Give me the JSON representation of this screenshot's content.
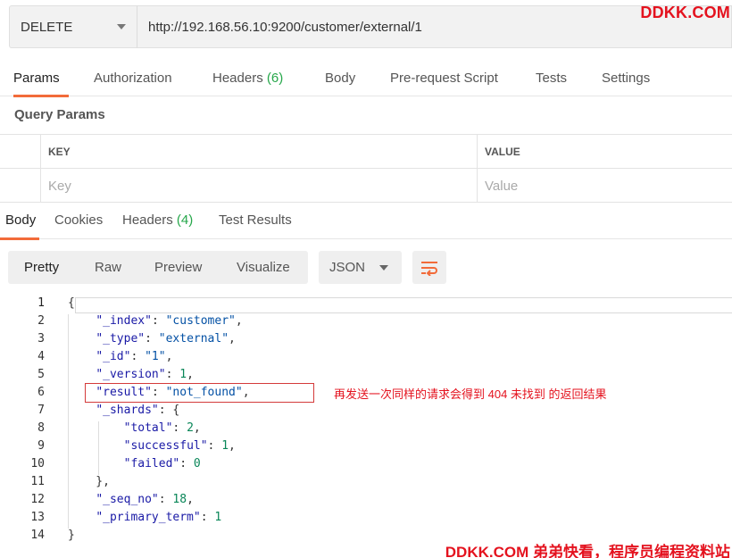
{
  "request": {
    "method": "DELETE",
    "url": "http://192.168.56.10:9200/customer/external/1"
  },
  "watermark_top": "DDKK.COM",
  "req_tabs": {
    "params": "Params",
    "authorization": "Authorization",
    "headers": "Headers",
    "headers_count": "(6)",
    "body": "Body",
    "prerequest": "Pre-request Script",
    "tests": "Tests",
    "settings": "Settings"
  },
  "query_params": {
    "title": "Query Params",
    "key_header": "KEY",
    "value_header": "VALUE",
    "key_placeholder": "Key",
    "value_placeholder": "Value"
  },
  "resp_tabs": {
    "body": "Body",
    "cookies": "Cookies",
    "headers": "Headers",
    "headers_count": "(4)",
    "test_results": "Test Results"
  },
  "view_modes": {
    "pretty": "Pretty",
    "raw": "Raw",
    "preview": "Preview",
    "visualize": "Visualize"
  },
  "format": "JSON",
  "code_lines": [
    {
      "n": "1",
      "t": "{"
    },
    {
      "n": "2",
      "t": "    \"_index\": \"customer\","
    },
    {
      "n": "3",
      "t": "    \"_type\": \"external\","
    },
    {
      "n": "4",
      "t": "    \"_id\": \"1\","
    },
    {
      "n": "5",
      "t": "    \"_version\": 1,"
    },
    {
      "n": "6",
      "t": "    \"result\": \"not_found\","
    },
    {
      "n": "7",
      "t": "    \"_shards\": {"
    },
    {
      "n": "8",
      "t": "        \"total\": 2,"
    },
    {
      "n": "9",
      "t": "        \"successful\": 1,"
    },
    {
      "n": "10",
      "t": "        \"failed\": 0"
    },
    {
      "n": "11",
      "t": "    },"
    },
    {
      "n": "12",
      "t": "    \"_seq_no\": 18,"
    },
    {
      "n": "13",
      "t": "    \"_primary_term\": 1"
    },
    {
      "n": "14",
      "t": "}"
    }
  ],
  "annotation": "再发送一次同样的请求会得到 404 未找到 的返回结果",
  "watermark_bottom": "DDKK.COM 弟弟快看，程序员编程资料站",
  "colors": {
    "accent": "#f26b3a",
    "count": "#26a74a",
    "watermark": "#e4121e"
  }
}
